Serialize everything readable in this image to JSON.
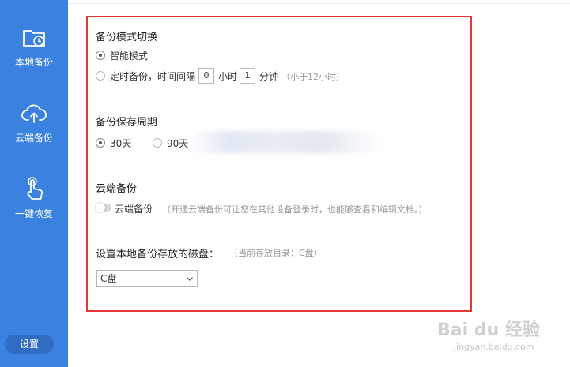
{
  "sidebar": {
    "items": [
      {
        "label": "本地备份",
        "icon": "folder-clock-icon"
      },
      {
        "label": "云端备份",
        "icon": "cloud-upload-icon"
      },
      {
        "label": "一键恢复",
        "icon": "hand-tap-icon"
      }
    ],
    "settings_label": "设置"
  },
  "mode": {
    "title": "备份模式切换",
    "option_smart": "智能模式",
    "option_timed": "定时备份，时间间隔",
    "hours_value": "0",
    "hours_unit": "小时",
    "minutes_value": "1",
    "minutes_unit": "分钟",
    "hint": "（小于12小时）",
    "selected": "智能模式"
  },
  "retention": {
    "title": "备份保存周期",
    "option_30": "30天",
    "option_90": "90天",
    "selected": "30天"
  },
  "cloud": {
    "title": "云端备份",
    "toggle_label": "云端备份",
    "toggle_on": false,
    "hint": "（开通云端备份可让您在其他设备登录时，也能够查看和编辑文档。）"
  },
  "disk": {
    "title": "设置本地备份存放的磁盘：",
    "hint": "（当前存放目录：C盘）",
    "selected": "C盘"
  },
  "watermark": {
    "brand": "Bai du 经验",
    "url": "jingyan.baidu.com"
  },
  "colors": {
    "sidebar": "#3b82e0",
    "highlight_border": "#e53935"
  }
}
